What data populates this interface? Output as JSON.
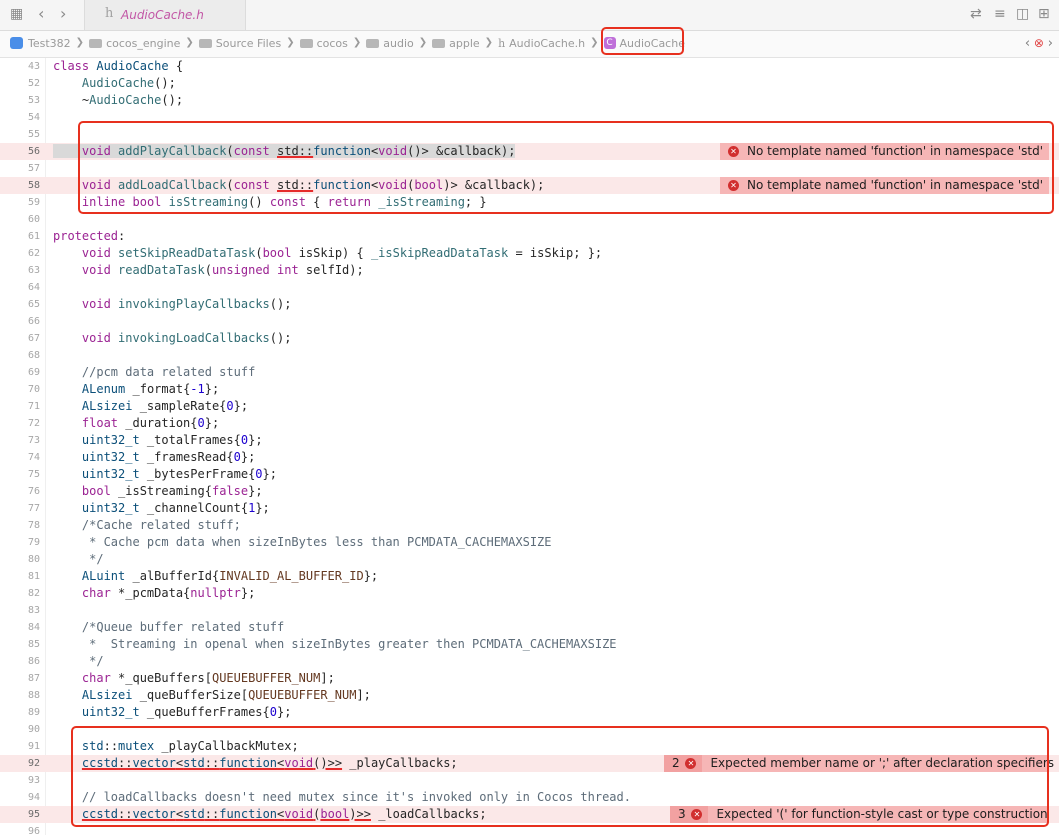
{
  "tab": {
    "file_label": "AudioCache.h"
  },
  "path": {
    "items": [
      "Test382",
      "cocos_engine",
      "Source Files",
      "cocos",
      "audio",
      "apple",
      "AudioCache.h",
      "AudioCache"
    ]
  },
  "code": {
    "lines": [
      {
        "n": "43",
        "html": "<span class='k'>class</span> <span class='t'>AudioCache</span> {"
      },
      {
        "n": "52",
        "html": "    <span class='f'>AudioCache</span>();"
      },
      {
        "n": "53",
        "html": "    ~<span class='f'>AudioCache</span>();"
      },
      {
        "n": "54",
        "html": ""
      },
      {
        "n": "55",
        "html": ""
      },
      {
        "n": "56",
        "err": true,
        "html": "<span class='hl'>    <span class='k'>void</span> <span class='f'>addPlayCallback</span>(<span class='k'>const</span> <span class='sq'>std::</span><span class='t'>function</span>&lt;<span class='k'>void</span>()&gt; &amp;callback);</span>"
      },
      {
        "n": "57",
        "html": ""
      },
      {
        "n": "58",
        "err": true,
        "html": "    <span class='k'>void</span> <span class='f'>addLoadCallback</span>(<span class='k'>const</span> <span class='sq'>std::</span><span class='t'>function</span>&lt;<span class='k'>void</span>(<span class='k'>bool</span>)&gt; &amp;callback);"
      },
      {
        "n": "59",
        "html": "    <span class='k'>inline</span> <span class='k'>bool</span> <span class='f'>isStreaming</span>() <span class='k'>const</span> { <span class='k'>return</span> <span class='f'>_isStreaming</span>; }"
      },
      {
        "n": "60",
        "html": ""
      },
      {
        "n": "61",
        "html": "<span class='k'>protected</span>:"
      },
      {
        "n": "62",
        "html": "    <span class='k'>void</span> <span class='f'>setSkipReadDataTask</span>(<span class='k'>bool</span> isSkip) { <span class='f'>_isSkipReadDataTask</span> = isSkip; };"
      },
      {
        "n": "63",
        "html": "    <span class='k'>void</span> <span class='f'>readDataTask</span>(<span class='k'>unsigned</span> <span class='k'>int</span> selfId);"
      },
      {
        "n": "64",
        "html": ""
      },
      {
        "n": "65",
        "html": "    <span class='k'>void</span> <span class='f'>invokingPlayCallbacks</span>();"
      },
      {
        "n": "66",
        "html": ""
      },
      {
        "n": "67",
        "html": "    <span class='k'>void</span> <span class='f'>invokingLoadCallbacks</span>();"
      },
      {
        "n": "68",
        "html": ""
      },
      {
        "n": "69",
        "html": "    <span class='c'>//pcm data related stuff</span>"
      },
      {
        "n": "70",
        "html": "    <span class='t'>ALenum</span> _format{<span class='n'>-1</span>};"
      },
      {
        "n": "71",
        "html": "    <span class='t'>ALsizei</span> _sampleRate{<span class='n'>0</span>};"
      },
      {
        "n": "72",
        "html": "    <span class='k'>float</span> _duration{<span class='n'>0</span>};"
      },
      {
        "n": "73",
        "html": "    <span class='t'>uint32_t</span> _totalFrames{<span class='n'>0</span>};"
      },
      {
        "n": "74",
        "html": "    <span class='t'>uint32_t</span> _framesRead{<span class='n'>0</span>};"
      },
      {
        "n": "75",
        "html": "    <span class='t'>uint32_t</span> _bytesPerFrame{<span class='n'>0</span>};"
      },
      {
        "n": "76",
        "html": "    <span class='k'>bool</span> _isStreaming{<span class='k'>false</span>};"
      },
      {
        "n": "77",
        "html": "    <span class='t'>uint32_t</span> _channelCount{<span class='n'>1</span>};"
      },
      {
        "n": "78",
        "html": "    <span class='c'>/*Cache related stuff;</span>"
      },
      {
        "n": "79",
        "html": "<span class='c'>     * Cache pcm data when sizeInBytes less than PCMDATA_CACHEMAXSIZE</span>"
      },
      {
        "n": "80",
        "html": "<span class='c'>     */</span>"
      },
      {
        "n": "81",
        "html": "    <span class='t'>ALuint</span> _alBufferId{<span class='m'>INVALID_AL_BUFFER_ID</span>};"
      },
      {
        "n": "82",
        "html": "    <span class='k'>char</span> *_pcmData{<span class='k'>nullptr</span>};"
      },
      {
        "n": "83",
        "html": ""
      },
      {
        "n": "84",
        "html": "    <span class='c'>/*Queue buffer related stuff</span>"
      },
      {
        "n": "85",
        "html": "<span class='c'>     *  Streaming in openal when sizeInBytes greater then PCMDATA_CACHEMAXSIZE</span>"
      },
      {
        "n": "86",
        "html": "<span class='c'>     */</span>"
      },
      {
        "n": "87",
        "html": "    <span class='k'>char</span> *_queBuffers[<span class='m'>QUEUEBUFFER_NUM</span>];"
      },
      {
        "n": "88",
        "html": "    <span class='t'>ALsizei</span> _queBufferSize[<span class='m'>QUEUEBUFFER_NUM</span>];"
      },
      {
        "n": "89",
        "html": "    <span class='t'>uint32_t</span> _queBufferFrames{<span class='n'>0</span>};"
      },
      {
        "n": "90",
        "html": ""
      },
      {
        "n": "91",
        "html": "    <span class='t'>std</span>::<span class='t'>mutex</span> _playCallbackMutex;"
      },
      {
        "n": "92",
        "err": true,
        "html": "    <span class='sq'><span class='t'>ccstd</span>::<span class='t'>vector</span>&lt;<span class='t'>std</span>::<span class='t'>function</span>&lt;<span class='k'>void</span>()&gt;&gt;</span> _playCallbacks;"
      },
      {
        "n": "93",
        "html": ""
      },
      {
        "n": "94",
        "html": "    <span class='c'>// loadCallbacks doesn't need mutex since it's invoked only in Cocos thread.</span>"
      },
      {
        "n": "95",
        "err": true,
        "html": "    <span class='sq'><span class='t'>ccstd</span>::<span class='t'>vector</span>&lt;<span class='t'>std</span>::<span class='t'>function</span>&lt;<span class='k'>void</span>(<span class='k'>bool</span>)&gt;&gt;</span> _loadCallbacks;"
      },
      {
        "n": "96",
        "html": ""
      }
    ]
  },
  "errors": [
    {
      "line": "56",
      "count": "",
      "message": "No template named 'function' in namespace 'std'"
    },
    {
      "line": "58",
      "count": "",
      "message": "No template named 'function' in namespace 'std'"
    },
    {
      "line": "92",
      "count": "2",
      "message": "Expected member name or ';' after declaration specifiers"
    },
    {
      "line": "95",
      "count": "3",
      "message": "Expected '(' for function-style cast or type construction"
    }
  ],
  "colors": {
    "error_box": "#e7301e",
    "error_bg": "#f6b6b6",
    "line_error_bg": "#fbe8e8"
  }
}
